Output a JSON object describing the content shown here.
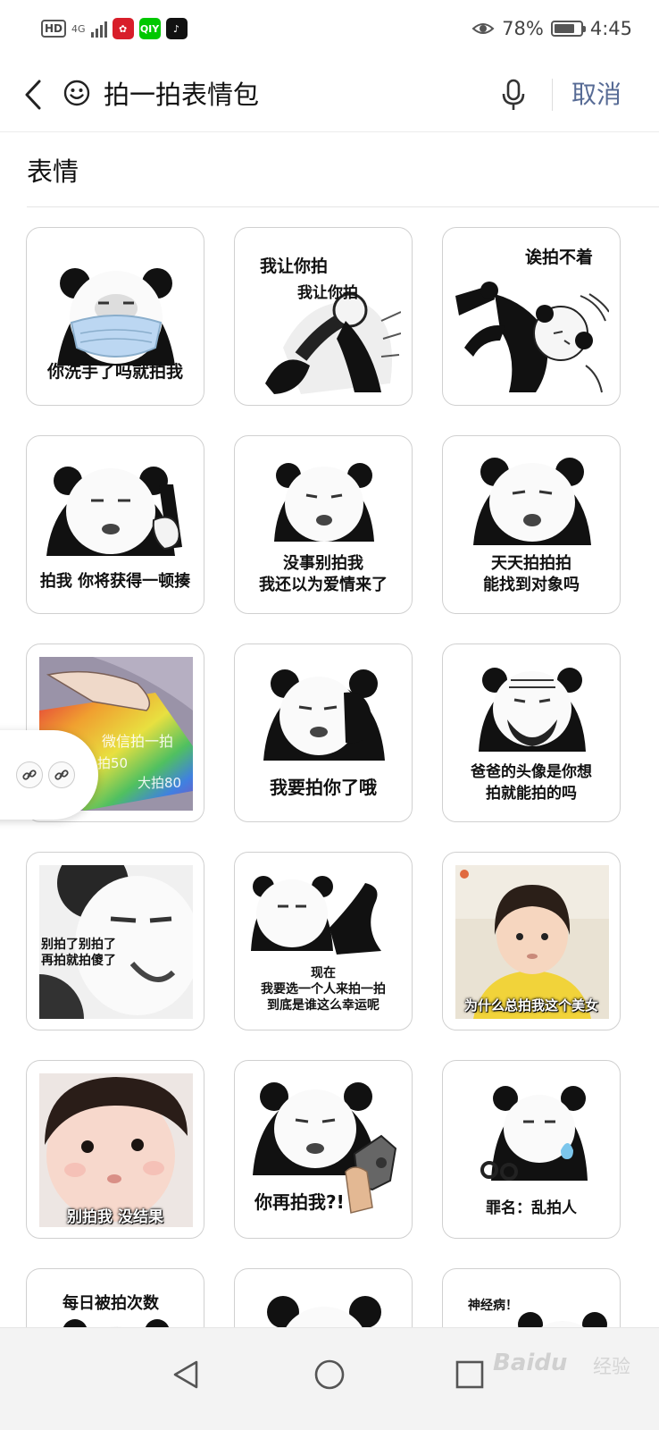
{
  "status_bar": {
    "hd": "HD",
    "network": "4G",
    "battery_percent": "78%",
    "battery_level": 0.78,
    "time": "4:45",
    "app_icons": [
      "pinduoduo-icon",
      "iqiyi-icon",
      "tiktok-icon"
    ],
    "iqiyi_label": "QIY"
  },
  "search": {
    "query": "拍一拍表情包",
    "cancel_label": "取消"
  },
  "section": {
    "title": "表情"
  },
  "stickers": [
    {
      "caption": "你洗手了吗就拍我"
    },
    {
      "caption_top_1": "我让你拍",
      "caption_top_2": "我让你拍"
    },
    {
      "caption_top": "诶拍不着"
    },
    {
      "caption": "拍我 你将获得一顿揍"
    },
    {
      "caption_1": "没事别拍我",
      "caption_2": "我还以为爱情来了"
    },
    {
      "caption_1": "天天拍拍拍",
      "caption_2": "能找到对象吗"
    },
    {
      "overlay_1": "微信拍一拍",
      "overlay_2": "小拍50",
      "overlay_3": "大拍80"
    },
    {
      "caption": "我要拍你了哦"
    },
    {
      "caption_1": "爸爸的头像是你想",
      "caption_2": "拍就能拍的吗"
    },
    {
      "caption_1": "别拍了别拍了",
      "caption_2": "再拍就拍傻了"
    },
    {
      "caption_1": "现在",
      "caption_2": "我要选一个人来拍一拍",
      "caption_3": "到底是谁这么幸运呢"
    },
    {
      "caption": "为什么总拍我这个美女"
    },
    {
      "caption": "别拍我 没结果"
    },
    {
      "caption": "你再拍我?!"
    },
    {
      "caption": "罪名：乱拍人"
    },
    {
      "caption_top": "每日被拍次数"
    },
    {},
    {
      "caption_top": "神经病！"
    }
  ],
  "watermark": {
    "brand": "Baidu",
    "suffix": "经验"
  },
  "colors": {
    "cancel": "#576b95",
    "tile_border": "#d0d0d0",
    "navbar_bg": "#f3f3f3"
  }
}
